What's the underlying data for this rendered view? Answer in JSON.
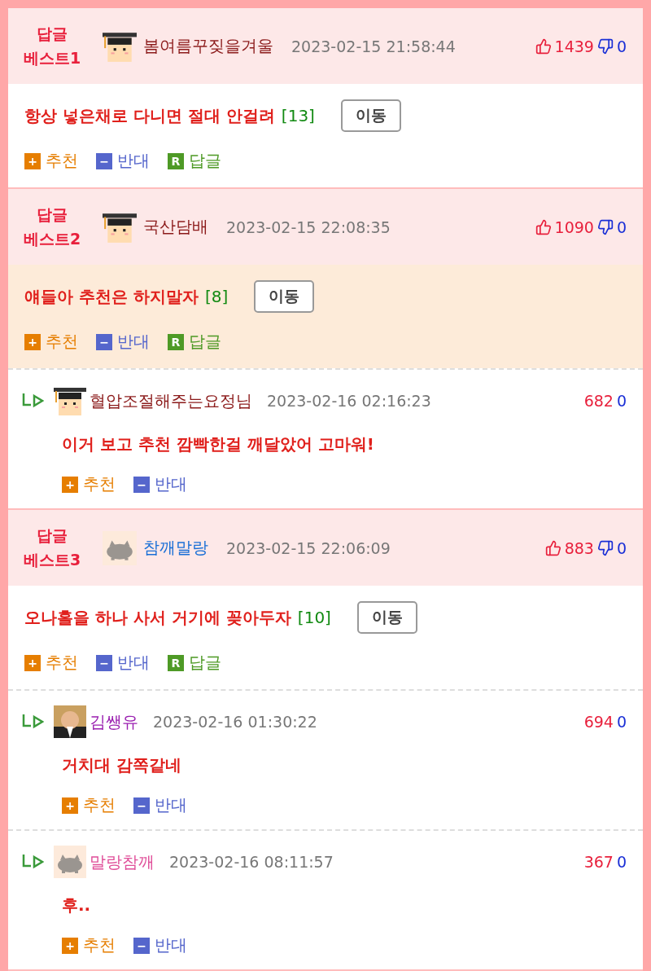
{
  "best_comments": [
    {
      "badge": [
        "답글",
        "베스트1"
      ],
      "avatar": {
        "kind": "graduate"
      },
      "nick": "봄여름꾸짖을겨울",
      "color": "#8b1a1a",
      "date": "2023-02-15 21:58:44",
      "up": "1439",
      "down": "0",
      "text": "항상 넣은채로 다니면 절대 안걸려",
      "reply_count": "[13]",
      "move_button": "이동",
      "highlighted": false,
      "actions": [
        {
          "kind": "up",
          "icon": "+",
          "label": "추천"
        },
        {
          "kind": "down",
          "icon": "−",
          "label": "반대"
        },
        {
          "kind": "reply",
          "icon": "R",
          "label": "답글"
        }
      ]
    },
    {
      "badge": [
        "답글",
        "베스트2"
      ],
      "avatar": {
        "kind": "graduate"
      },
      "nick": "국산담배",
      "color": "#8b1a1a",
      "date": "2023-02-15 22:08:35",
      "up": "1090",
      "down": "0",
      "text": "얘들아 추천은 하지말자",
      "reply_count": "[8]",
      "move_button": "이동",
      "highlighted": true,
      "actions": [
        {
          "kind": "up",
          "icon": "+",
          "label": "추천"
        },
        {
          "kind": "down",
          "icon": "−",
          "label": "반대"
        },
        {
          "kind": "reply",
          "icon": "R",
          "label": "답글"
        }
      ],
      "replies": [
        {
          "avatar": {
            "kind": "graduate"
          },
          "nick": "혈압조절해주는요정님",
          "color": "#8b1a1a",
          "date": "2023-02-16 02:16:23",
          "up": "682",
          "down": "0",
          "text": "이거 보고 추천 깜빡한걸 깨달았어 고마워!",
          "actions": [
            {
              "kind": "up",
              "icon": "+",
              "label": "추천"
            },
            {
              "kind": "down",
              "icon": "−",
              "label": "반대"
            }
          ]
        }
      ]
    },
    {
      "badge": [
        "답글",
        "베스트3"
      ],
      "avatar": {
        "kind": "cat"
      },
      "nick": "참깨말랑",
      "color": "#1a6fd6",
      "date": "2023-02-15 22:06:09",
      "up": "883",
      "down": "0",
      "text": "오나홀을 하나 사서 거기에 꽂아두자",
      "reply_count": "[10]",
      "move_button": "이동",
      "highlighted": false,
      "actions": [
        {
          "kind": "up",
          "icon": "+",
          "label": "추천"
        },
        {
          "kind": "down",
          "icon": "−",
          "label": "반대"
        },
        {
          "kind": "reply",
          "icon": "R",
          "label": "답글"
        }
      ],
      "replies": [
        {
          "avatar": {
            "kind": "picture"
          },
          "nick": "김쌩유",
          "color": "#9a1fb0",
          "date": "2023-02-16 01:30:22",
          "up": "694",
          "down": "0",
          "text": "거치대 감쪽같네",
          "actions": [
            {
              "kind": "up",
              "icon": "+",
              "label": "추천"
            },
            {
              "kind": "down",
              "icon": "−",
              "label": "반대"
            }
          ]
        },
        {
          "avatar": {
            "kind": "cat"
          },
          "nick": "말랑참깨",
          "color": "#e0509a",
          "date": "2023-02-16 08:11:57",
          "up": "367",
          "down": "0",
          "text": "후..",
          "actions": [
            {
              "kind": "up",
              "icon": "+",
              "label": "추천"
            },
            {
              "kind": "down",
              "icon": "−",
              "label": "반대"
            }
          ]
        }
      ]
    }
  ]
}
